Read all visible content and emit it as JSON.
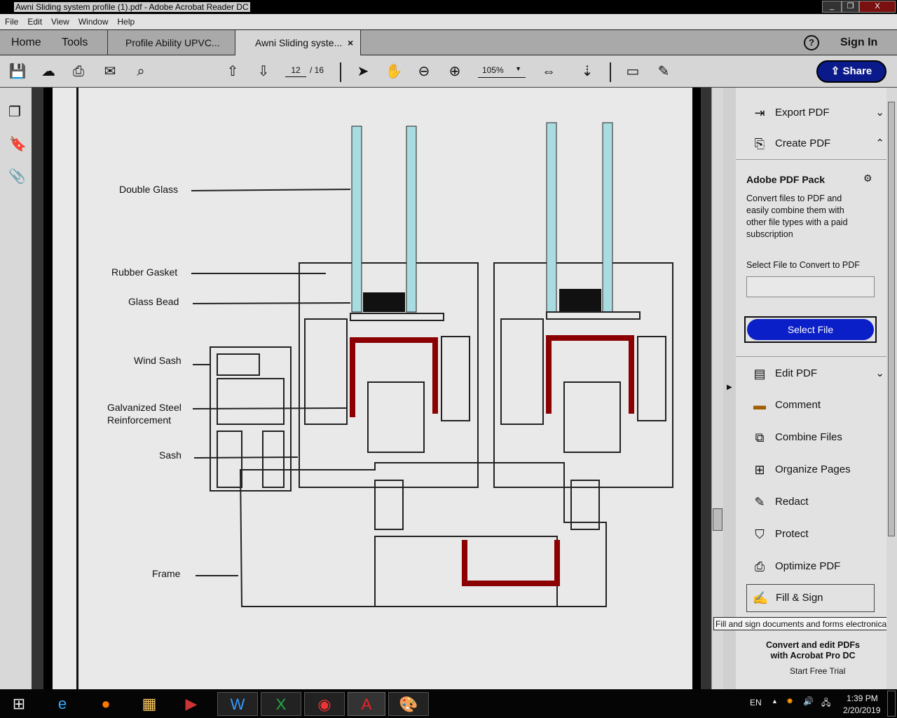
{
  "window": {
    "title": "Awni Sliding system profile (1).pdf - Adobe Acrobat Reader DC",
    "minimize": "_",
    "restore": "❐",
    "close": "X"
  },
  "menu": [
    "File",
    "Edit",
    "View",
    "Window",
    "Help"
  ],
  "tabs": {
    "home": "Home",
    "tools": "Tools",
    "doc1": "Profile Ability UPVC...",
    "doc2": "Awni Sliding syste...",
    "close": "×",
    "help": "?",
    "sign_in": "Sign In"
  },
  "toolbar": {
    "page_current": "12",
    "page_total": "/ 16",
    "zoom": "105%",
    "share": "Share"
  },
  "diagram": {
    "labels": [
      "Double Glass",
      "Rubber Gasket",
      "Glass Bead",
      "Wind Sash",
      "Galvanized Steel",
      "Reinforcement",
      "Sash",
      "Frame"
    ]
  },
  "right_panel": {
    "export_pdf": "Export PDF",
    "create_pdf": "Create PDF",
    "pack_title": "Adobe PDF Pack",
    "pack_desc": "Convert files to PDF and easily combine them with other file types with a paid subscription",
    "select_label": "Select File to Convert to PDF",
    "select_value": "",
    "select_button": "Select File",
    "tools": [
      "Edit PDF",
      "Comment",
      "Combine Files",
      "Organize Pages",
      "Redact",
      "Protect",
      "Optimize PDF",
      "Fill & Sign"
    ],
    "tooltip": "Fill and sign documents and forms electronically",
    "promo": "Convert and edit PDFs with Acrobat Pro DC",
    "trial": "Start Free Trial"
  },
  "taskbar": {
    "lang": "EN",
    "time": "1:39 PM",
    "date": "2/20/2019"
  },
  "colors": {
    "share_button": "#0a1a8a",
    "select_button": "#0b1fc8",
    "glass": "#a8dce0",
    "steel": "#8b0000"
  }
}
